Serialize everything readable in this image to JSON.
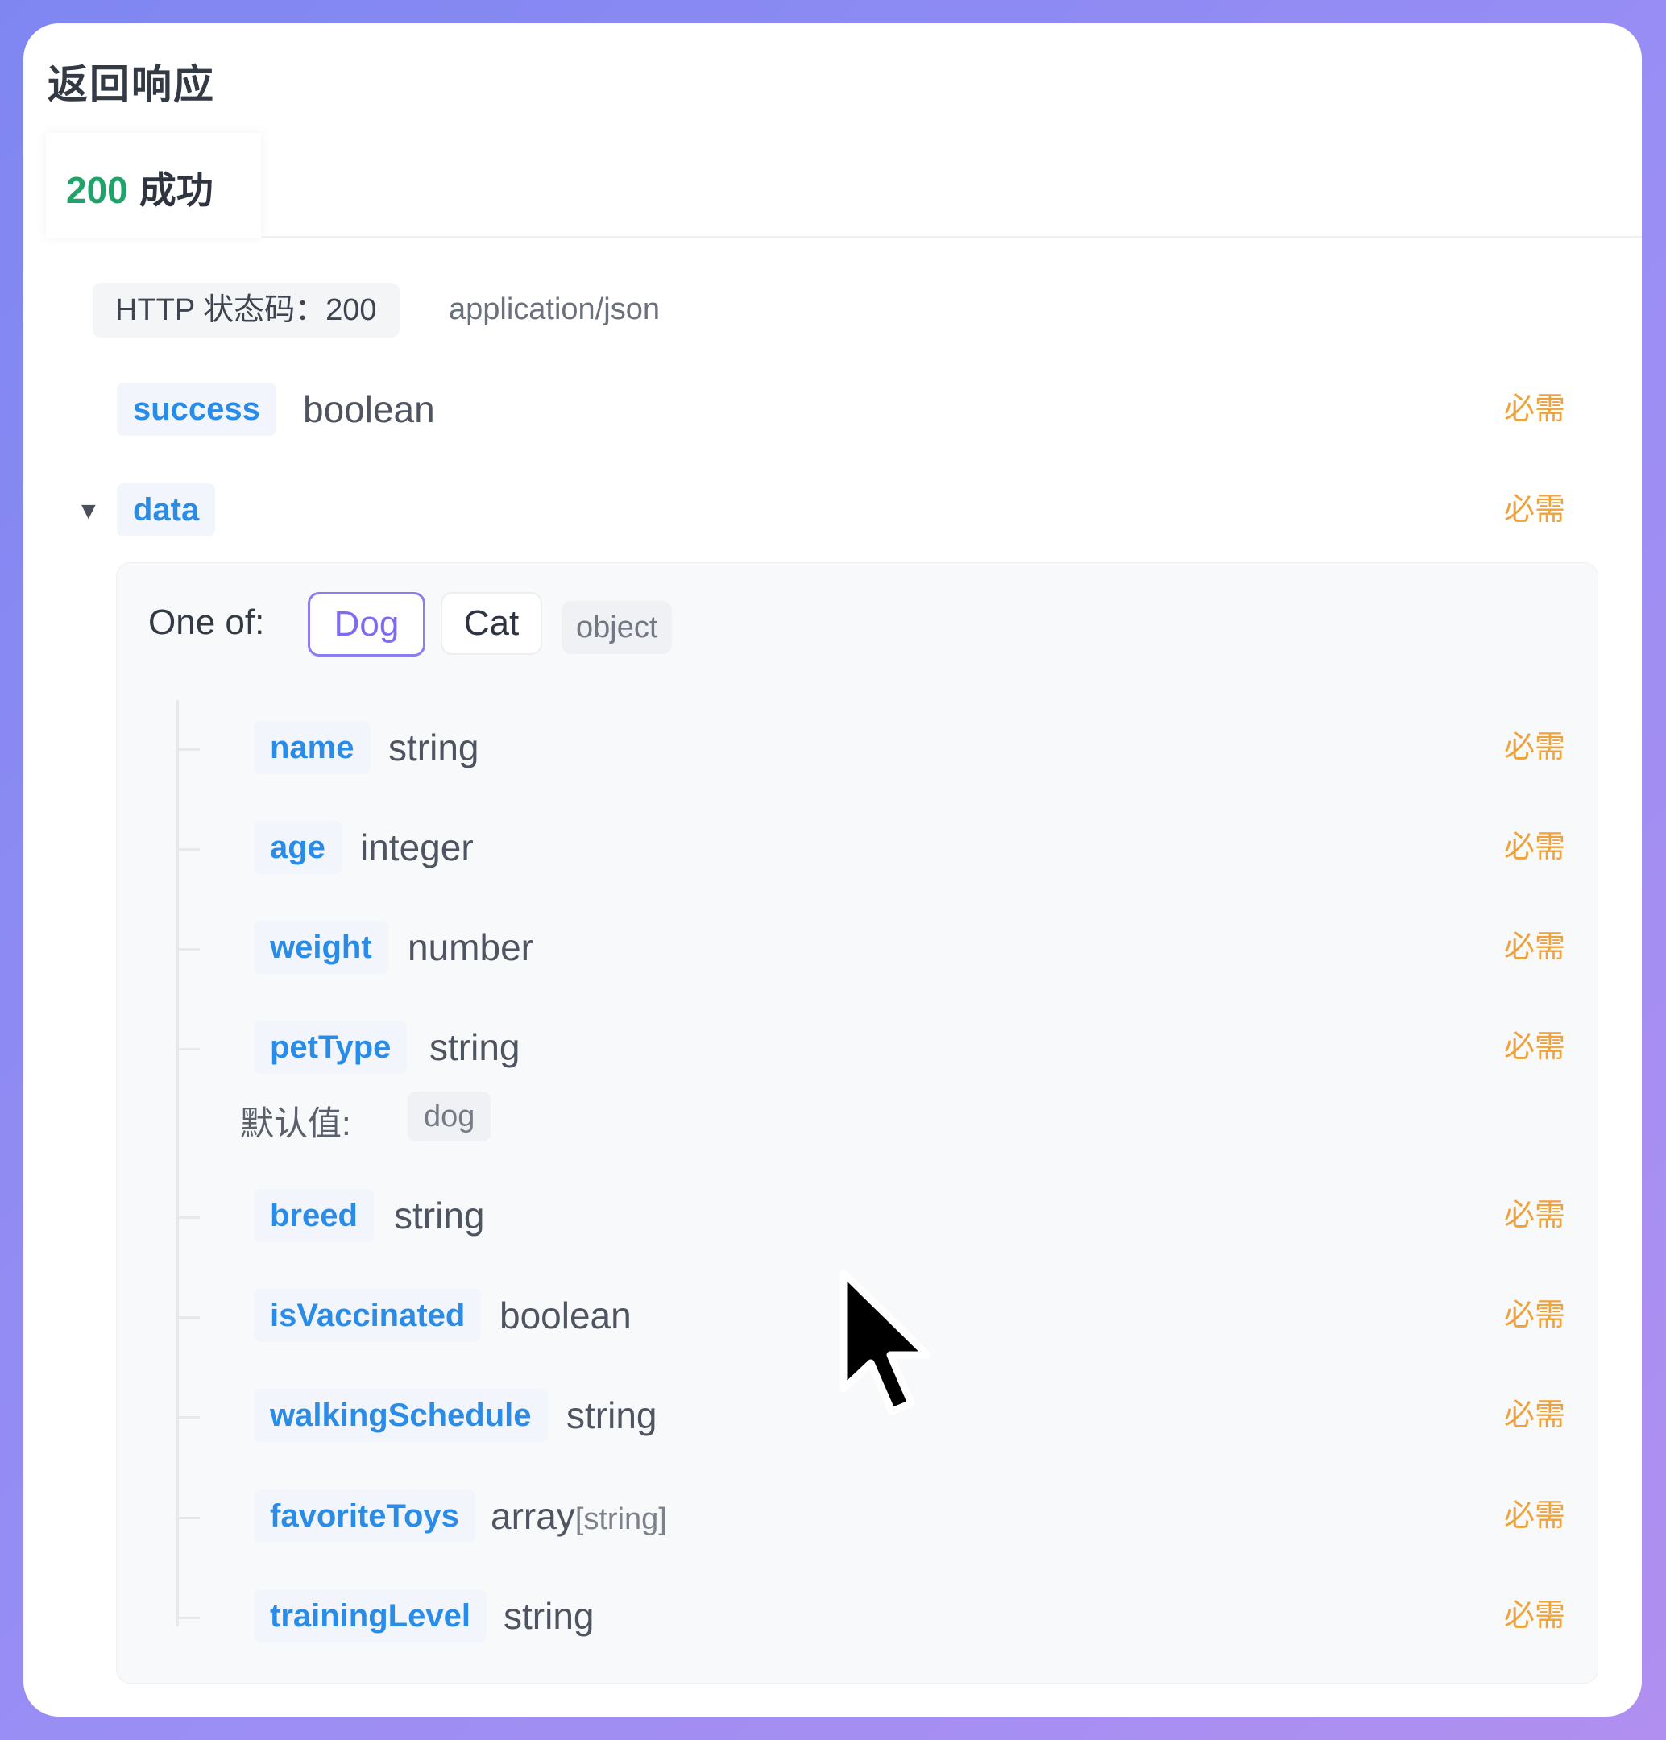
{
  "section_title": "返回响应",
  "response_tab": {
    "code": "200",
    "label": "成功"
  },
  "status": {
    "pill": "HTTP 状态码：200",
    "content_type": "application/json"
  },
  "required_label": "必需",
  "top_fields": [
    {
      "name": "success",
      "type": "boolean"
    },
    {
      "name": "data",
      "type": ""
    }
  ],
  "data_panel": {
    "one_of_label": "One of:",
    "options": [
      "Dog",
      "Cat"
    ],
    "selected": "Dog",
    "type": "object",
    "fields": [
      {
        "name": "name",
        "type": "string"
      },
      {
        "name": "age",
        "type": "integer"
      },
      {
        "name": "weight",
        "type": "number"
      },
      {
        "name": "petType",
        "type": "string"
      },
      {
        "name": "breed",
        "type": "string"
      },
      {
        "name": "isVaccinated",
        "type": "boolean"
      },
      {
        "name": "walkingSchedule",
        "type": "string"
      },
      {
        "name": "favoriteToys",
        "type": "array",
        "subtype": "[string]"
      },
      {
        "name": "trainingLevel",
        "type": "string"
      }
    ],
    "default": {
      "label": "默认值:",
      "value": "dog"
    }
  },
  "colors": {
    "accent": "#2a8ce6",
    "required": "#f0a23a",
    "success_code": "#1fa36a",
    "selected_option": "#7d6cf2"
  },
  "icons": {
    "collapse": "caret-down-icon",
    "pointer": "mouse-cursor-icon"
  }
}
